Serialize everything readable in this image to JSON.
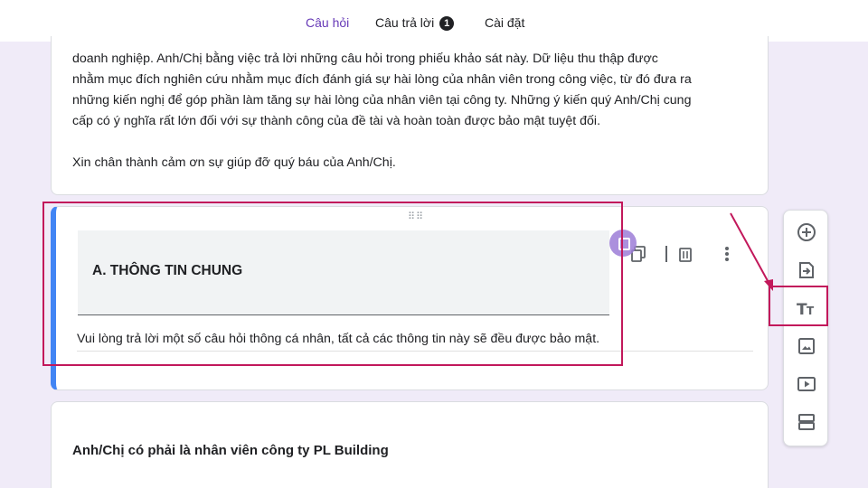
{
  "tabs": {
    "questions": "Câu hỏi",
    "responses": "Câu trả lời",
    "responses_count": "1",
    "settings": "Cài đặt"
  },
  "form_description": {
    "line1": "doanh nghiệp. Anh/Chị bằng việc trả lời những câu hỏi trong phiếu khảo sát này. Dữ liệu thu thập được",
    "line2": "nhằm mục đích nghiên cứu nhằm mục đích đánh giá sự hài lòng của nhân viên trong công việc, từ đó đưa ra",
    "line3": "những kiến nghị để góp phần làm tăng sự hài lòng của nhân viên tại công ty. Những ý kiến quý Anh/Chị cung",
    "line4": "cấp có ý nghĩa rất lớn đối với sự thành công của đề tài và hoàn toàn được bảo mật tuyệt đối.",
    "thanks": "Xin chân thành cảm ơn sự giúp đỡ quý báu của Anh/Chị."
  },
  "section": {
    "title": "A. THÔNG TIN CHUNG",
    "description": "Vui lòng trả lời một số câu hỏi thông cá nhân, tất cả các thông tin này sẽ đều được bảo mật."
  },
  "question": {
    "text": "Anh/Chị có phải là nhân viên công ty PL Building"
  },
  "icons": {
    "drag": "drag-handle-icon",
    "duplicate": "duplicate-icon",
    "delete": "trash-icon",
    "more": "more-vert-icon",
    "add_question": "add-circle-icon",
    "import_questions": "import-icon",
    "add_title": "title-text-icon",
    "add_image": "image-icon",
    "add_video": "video-icon",
    "add_section": "section-icon"
  },
  "colors": {
    "accent": "#673ab7",
    "background": "#f0ebf8",
    "active_border": "#4285f4",
    "annotation": "#c2185b"
  }
}
